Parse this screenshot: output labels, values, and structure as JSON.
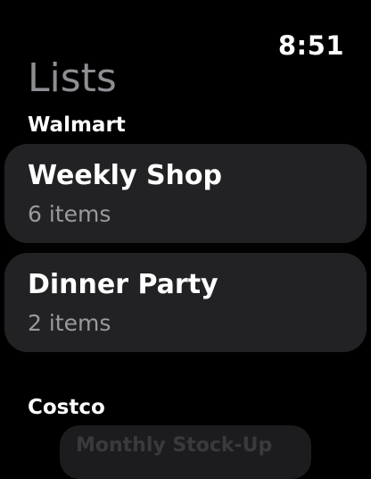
{
  "status_bar": {
    "time": "8:51"
  },
  "header": {
    "title": "Lists"
  },
  "sections": [
    {
      "name": "Walmart",
      "lists": [
        {
          "title": "Weekly Shop",
          "subtitle": "6 items"
        },
        {
          "title": "Dinner Party",
          "subtitle": "2 items"
        }
      ]
    },
    {
      "name": "Costco",
      "lists": [
        {
          "title": "Monthly Stock-Up"
        }
      ]
    }
  ],
  "colors": {
    "background": "#000000",
    "card": "#222224",
    "title_muted": "#8e8e93",
    "subtitle": "#9a9a9e"
  }
}
